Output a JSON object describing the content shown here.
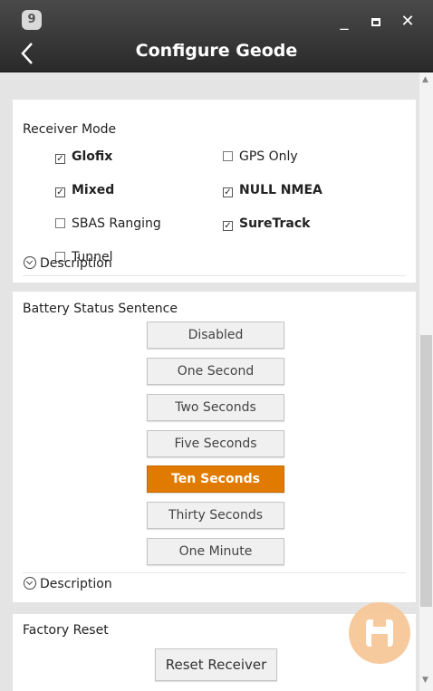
{
  "window": {
    "app_icon_text": "9",
    "title": "Configure Geode",
    "controls": {
      "minimize": "_",
      "close": "✕"
    }
  },
  "receiver_mode": {
    "title": "Receiver Mode",
    "options": [
      {
        "label": "Glofix",
        "checked": true
      },
      {
        "label": "GPS Only",
        "checked": false
      },
      {
        "label": "Mixed",
        "checked": true
      },
      {
        "label": "NULL NMEA",
        "checked": true
      },
      {
        "label": "SBAS Ranging",
        "checked": false
      },
      {
        "label": "SureTrack",
        "checked": true
      },
      {
        "label": "Tunnel",
        "checked": false
      }
    ],
    "description_label": "Description"
  },
  "battery_status": {
    "title": "Battery Status Sentence",
    "options": [
      {
        "label": "Disabled",
        "selected": false
      },
      {
        "label": "One Second",
        "selected": false
      },
      {
        "label": "Two Seconds",
        "selected": false
      },
      {
        "label": "Five Seconds",
        "selected": false
      },
      {
        "label": "Ten Seconds",
        "selected": true
      },
      {
        "label": "Thirty Seconds",
        "selected": false
      },
      {
        "label": "One Minute",
        "selected": false
      }
    ],
    "description_label": "Description",
    "selected_color": "#e17a00"
  },
  "factory_reset": {
    "title": "Factory Reset",
    "button_label": "Reset Receiver"
  },
  "fab": {
    "icon": "save-icon",
    "color": "#f6c898"
  },
  "check_mark": "✓"
}
